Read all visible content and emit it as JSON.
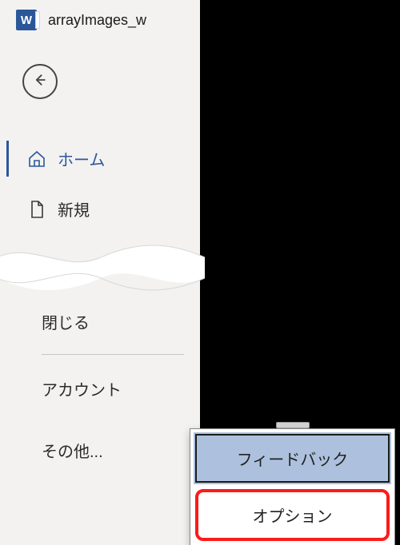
{
  "title": "arrayImages_w",
  "app_icon_letter": "W",
  "nav": {
    "home": {
      "label": "ホーム"
    },
    "new": {
      "label": "新規"
    }
  },
  "lower": {
    "close": {
      "label": "閉じる"
    },
    "account": {
      "label": "アカウント"
    },
    "more": {
      "label": "その他..."
    }
  },
  "popup": {
    "feedback": {
      "label": "フィードバック"
    },
    "options": {
      "label": "オプション"
    }
  }
}
